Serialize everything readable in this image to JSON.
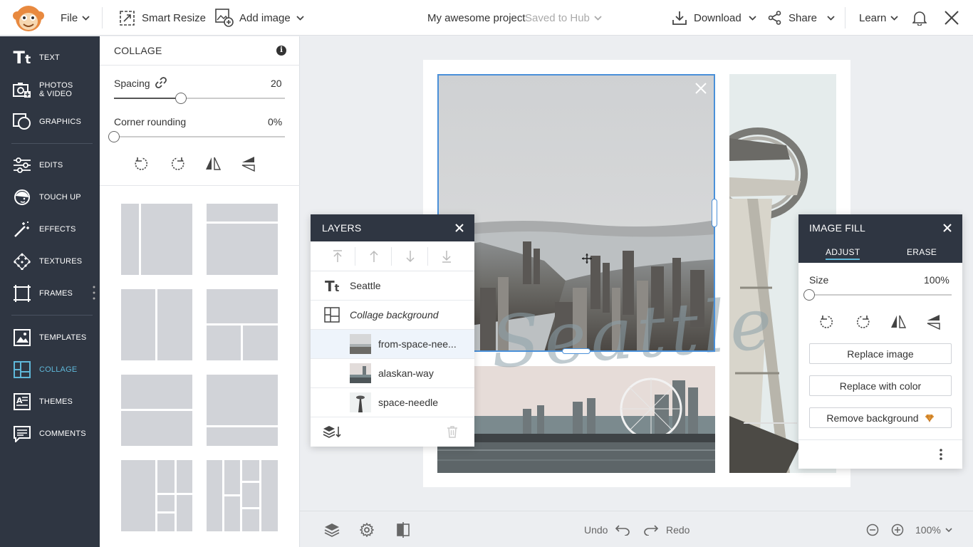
{
  "topbar": {
    "file": "File",
    "smart_resize": "Smart Resize",
    "add_image": "Add image",
    "project_name": "My awesome project",
    "saved_status": "Saved to Hub",
    "download": "Download",
    "share": "Share",
    "learn": "Learn"
  },
  "sidebar": {
    "items": [
      {
        "label": "TEXT",
        "icon": "text-icon"
      },
      {
        "label": "PHOTOS",
        "label2": "& VIDEO",
        "icon": "camera-icon"
      },
      {
        "label": "GRAPHICS",
        "icon": "shapes-icon"
      },
      {
        "label": "EDITS",
        "icon": "sliders-icon"
      },
      {
        "label": "TOUCH UP",
        "icon": "face-icon"
      },
      {
        "label": "EFFECTS",
        "icon": "magic-wand-icon"
      },
      {
        "label": "TEXTURES",
        "icon": "texture-icon"
      },
      {
        "label": "FRAMES",
        "icon": "frame-icon"
      },
      {
        "label": "TEMPLATES",
        "icon": "template-icon"
      },
      {
        "label": "COLLAGE",
        "icon": "collage-icon"
      },
      {
        "label": "THEMES",
        "icon": "themes-icon"
      },
      {
        "label": "COMMENTS",
        "icon": "comments-icon"
      }
    ]
  },
  "collage": {
    "title": "COLLAGE",
    "spacing_label": "Spacing",
    "spacing_value": "20",
    "spacing_fraction": 0.39,
    "corner_label": "Corner rounding",
    "corner_value": "0%",
    "corner_fraction": 0
  },
  "canvas": {
    "overlay_text": "Seattle"
  },
  "layers": {
    "title": "LAYERS",
    "rows": [
      {
        "name": "Seattle",
        "italic": false
      },
      {
        "name": "Collage background",
        "italic": true
      },
      {
        "name": "from-space-nee...",
        "selected": true
      },
      {
        "name": "alaskan-way"
      },
      {
        "name": "space-needle"
      }
    ]
  },
  "image_fill": {
    "title": "IMAGE FILL",
    "tab_adjust": "ADJUST",
    "tab_erase": "ERASE",
    "size_label": "Size",
    "size_value": "100%",
    "size_fraction": 0,
    "replace_image": "Replace image",
    "replace_color": "Replace with color",
    "remove_background": "Remove background"
  },
  "bottombar": {
    "undo": "Undo",
    "redo": "Redo",
    "zoom": "100%"
  },
  "colors": {
    "sidebar_bg": "#2f3642",
    "accent": "#5fb8d9",
    "selection": "#4a90d9",
    "premium": "#e59a3a"
  }
}
